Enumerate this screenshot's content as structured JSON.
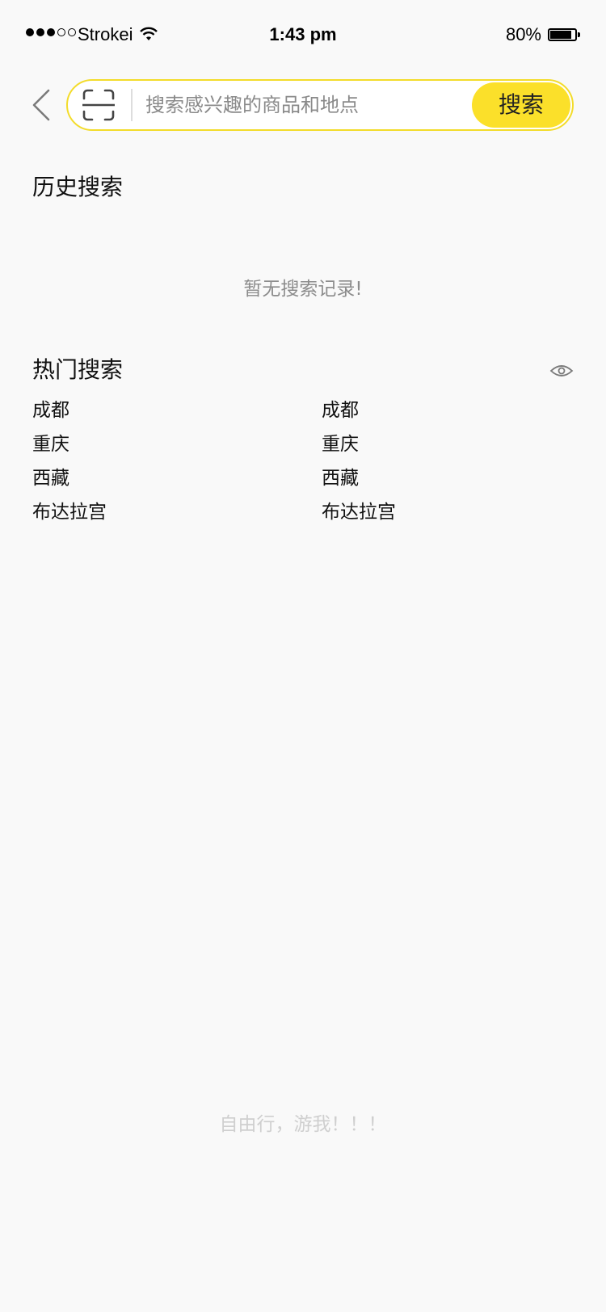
{
  "status_bar": {
    "carrier": "Strokei",
    "time": "1:43 pm",
    "battery": "80%",
    "battery_level": 0.8,
    "signal_bars": 3,
    "signal_total": 5
  },
  "header": {
    "search_placeholder": "搜索感兴趣的商品和地点",
    "search_button": "搜索",
    "accent_color": "#fbe02a",
    "icons": [
      "back-chevron-icon",
      "scan-icon"
    ]
  },
  "history": {
    "title": "历史搜索",
    "empty_message": "暂无搜索记录!"
  },
  "hot": {
    "title": "热门搜索",
    "eye_icon": "eye-icon",
    "items": [
      "成都",
      "成都",
      "重庆",
      "重庆",
      "西藏",
      "西藏",
      "布达拉宫",
      "布达拉宫"
    ]
  },
  "footer": {
    "slogan": "自由行，游我！！！"
  }
}
